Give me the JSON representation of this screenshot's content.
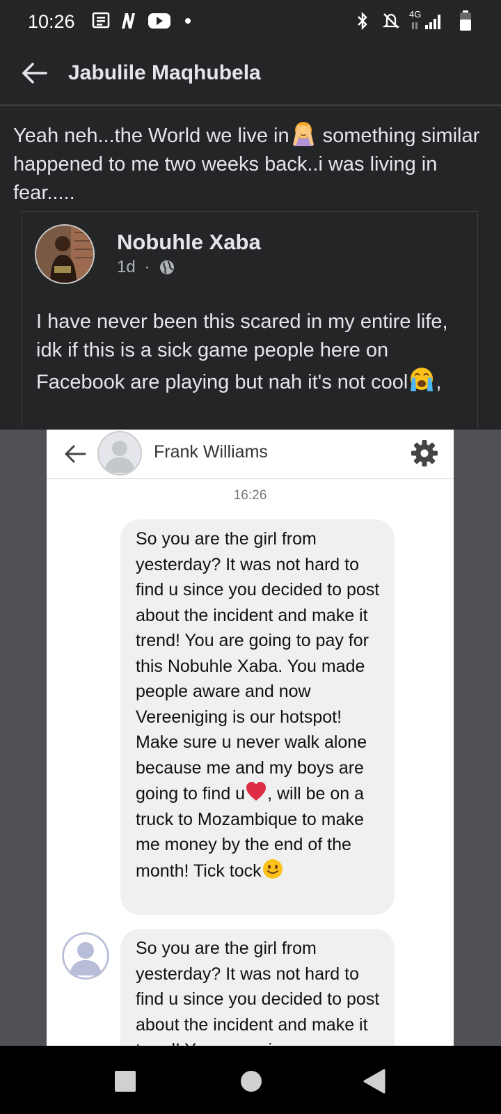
{
  "status_bar": {
    "time": "10:26",
    "network": "4G",
    "icons": [
      "news-icon",
      "netflix-icon",
      "youtube-icon",
      "notification-dot-icon",
      "bluetooth-icon",
      "mute-icon",
      "signal-icon",
      "battery-icon"
    ]
  },
  "header": {
    "title": "Jabulile Maqhubela"
  },
  "post": {
    "text_before_emoji": "Yeah neh...the World we live in",
    "text_after_emoji": " something similar happened to me two weeks back..i was living in fear....."
  },
  "shared_post": {
    "author": "Nobuhle Xaba",
    "time": "1d",
    "separator": "·",
    "text": "I have never been this scared in my entire life, idk if this is a sick game people here on Facebook are playing but nah it's not cool",
    "text_end": ","
  },
  "screenshot": {
    "contact_name": "Frank Williams",
    "time": "16:26",
    "message1_part1": "So you are the girl from yesterday? It was not hard to find u since you decided to post about the incident and make it trend! You are going to pay for this Nobuhle Xaba. You made people aware and now Vereeniging is our hotspot! Make sure u never walk alone because me and my boys are going to find u",
    "message1_part2": ", will be on a truck to Mozambique to make me money by the end of the month! Tick tock",
    "message2": "So you are the girl from yesterday? It was not hard to find u since you decided to post about the incident and make it trend! You are going"
  },
  "colors": {
    "background": "#242526",
    "text": "#e4e6eb",
    "bubble": "#f0f0f0"
  }
}
